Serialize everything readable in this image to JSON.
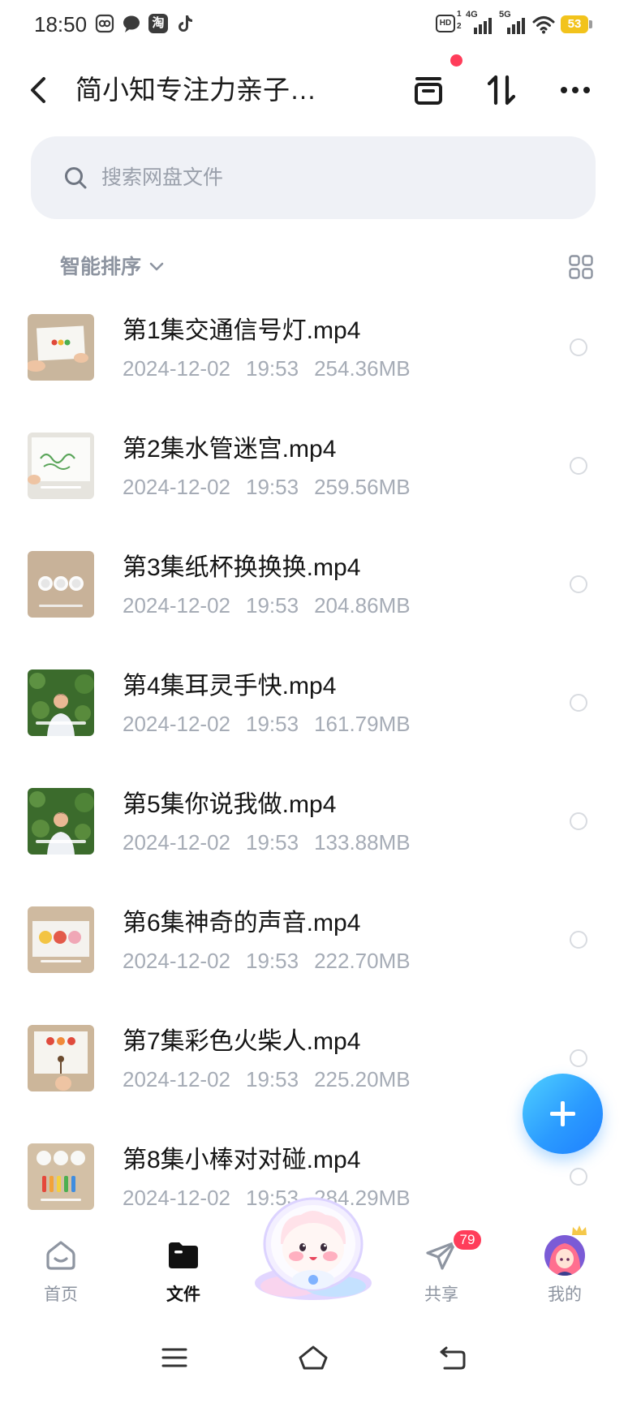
{
  "status_bar": {
    "time": "18:50",
    "left_icons": [
      "photo-album-icon",
      "chat-bubble-icon",
      "taobao-icon",
      "tiktok-icon"
    ],
    "taobao_glyph": "淘",
    "hd_label": "HD",
    "hd_sup": "1",
    "hd_sub": "2",
    "network_1": "4G",
    "network_2": "5G",
    "battery_level": "53"
  },
  "header": {
    "back_icon": "chevron-left-icon",
    "title": "简小知专注力亲子…",
    "actions": [
      "archive-box-icon",
      "transfer-icon",
      "more-icon"
    ],
    "notification_dot": true
  },
  "search": {
    "icon": "search-icon",
    "placeholder": "搜索网盘文件"
  },
  "sort": {
    "label": "智能排序",
    "icon": "chevron-down-icon",
    "view_toggle_icon": "grid-view-icon"
  },
  "files": [
    {
      "name": "第1集交通信号灯.mp4",
      "date": "2024-12-02",
      "time": "19:53",
      "size": "254.36MB",
      "thumbnail_icon": "traffic-light-paper-thumbnail",
      "selected": false
    },
    {
      "name": "第2集水管迷宫.mp4",
      "date": "2024-12-02",
      "time": "19:53",
      "size": "259.56MB",
      "thumbnail_icon": "maze-paper-thumbnail",
      "selected": false
    },
    {
      "name": "第3集纸杯换换换.mp4",
      "date": "2024-12-02",
      "time": "19:53",
      "size": "204.86MB",
      "thumbnail_icon": "paper-cups-thumbnail",
      "selected": false
    },
    {
      "name": "第4集耳灵手快.mp4",
      "date": "2024-12-02",
      "time": "19:53",
      "size": "161.79MB",
      "thumbnail_icon": "presenter-thumbnail",
      "selected": false
    },
    {
      "name": "第5集你说我做.mp4",
      "date": "2024-12-02",
      "time": "19:53",
      "size": "133.88MB",
      "thumbnail_icon": "presenter-thumbnail",
      "selected": false
    },
    {
      "name": "第6集神奇的声音.mp4",
      "date": "2024-12-02",
      "time": "19:53",
      "size": "222.70MB",
      "thumbnail_icon": "color-balls-thumbnail",
      "selected": false
    },
    {
      "name": "第7集彩色火柴人.mp4",
      "date": "2024-12-02",
      "time": "19:53",
      "size": "225.20MB",
      "thumbnail_icon": "stickman-thumbnail",
      "selected": false
    },
    {
      "name": "第8集小棒对对碰.mp4",
      "date": "2024-12-02",
      "time": "19:53",
      "size": "284.29MB",
      "thumbnail_icon": "color-sticks-thumbnail",
      "selected": false
    }
  ],
  "fab": {
    "icon": "plus-icon"
  },
  "bottom_nav": {
    "items": [
      {
        "label": "首页",
        "icon": "home-icon",
        "active": false
      },
      {
        "label": "文件",
        "icon": "folder-icon",
        "active": true
      },
      {
        "label": "共享",
        "icon": "paper-plane-icon",
        "active": false,
        "badge": "79"
      },
      {
        "label": "我的",
        "icon": "avatar-icon",
        "active": false
      }
    ],
    "center_icon": "mascot-icon"
  },
  "system_nav": [
    "menu-icon",
    "home-outline-icon",
    "back-icon"
  ],
  "colors": {
    "accent": "#2b8dff",
    "badge": "#ff3d5a",
    "muted": "#8d94a0",
    "meta": "#a6acb6"
  }
}
